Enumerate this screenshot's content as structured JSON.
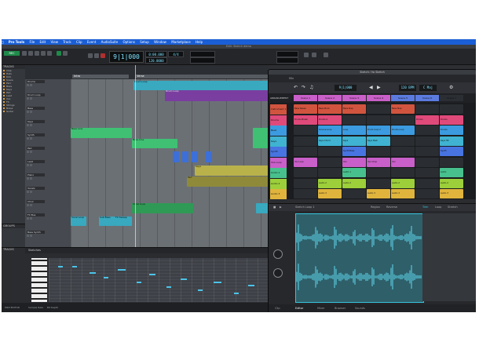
{
  "menubar": {
    "app_name": "Pro Tools",
    "items": [
      "File",
      "Edit",
      "View",
      "Track",
      "Clip",
      "Event",
      "AudioSuite",
      "Options",
      "Setup",
      "Window",
      "Marketplace",
      "Help"
    ]
  },
  "window_title": "Edit: Sketch demo",
  "transport": {
    "main_counter": "9|1|000",
    "sub_counter": "0:00.000",
    "tempo": "120.0000",
    "meter": "4/4",
    "record_button": "REC"
  },
  "tracklist": {
    "header": "TRACKS",
    "rows": [
      "Clap",
      "Hats",
      "Kick",
      "Snare",
      "Perc",
      "Bass",
      "Keys",
      "Pad",
      "Lead",
      "Vox",
      "FX",
      "Strings",
      "Brass",
      "Guitar"
    ]
  },
  "groups_header": "GROUPS",
  "edit": {
    "markers": [
      "Intro",
      "Verse"
    ],
    "track_names": [
      "Drums",
      "Drum Loop",
      "Bass",
      "Keys",
      "Synth",
      "Pad",
      "Lead",
      "Piano",
      "Vocals",
      "Choir",
      "FX Bus",
      "Bass Synth"
    ],
    "clip_labels": [
      "Drum Loop",
      "Drum Loop",
      "Bass Line",
      "Bass Line",
      "Keys",
      "Pad",
      "Vocal Loop",
      "Vocal Loop",
      "Sub Bass",
      "FX Sweep"
    ]
  },
  "bottom": {
    "tab": "Sketches",
    "status": "Midi Editor"
  },
  "statusbar": {
    "left": "MIDI EDITOR",
    "mid": "Sample Rate",
    "right": "Bit Depth"
  },
  "sketch": {
    "title": "Sketch: Ho Sketch",
    "bar": "Mix",
    "tempo_display": "120 BPM",
    "key_display": "C Maj",
    "counter": "9|1|000",
    "scene_label": "ARRANGEMENT",
    "scenes": [
      "Scene 1",
      "Scene 2",
      "Scene 3",
      "Scene 4",
      "Scene 5",
      "Scene 6",
      "Scene 7"
    ],
    "rows": [
      {
        "label": "Instrument 1",
        "color": "#d1543f",
        "cells": [
          "Bass Reese",
          "Bass Pluck",
          "Bass Slap",
          "",
          "Bass Slap",
          "",
          ""
        ]
      },
      {
        "label": "Drums",
        "color": "#e04a7b",
        "cells": [
          "Drums Break",
          "Drums A",
          "",
          "",
          "",
          "Drums",
          "Drums"
        ]
      },
      {
        "label": "Beat",
        "color": "#3c9be0",
        "cells": [
          "",
          "Groove Loop",
          "Loop",
          "Drum Loop 2",
          "Drums Loop",
          "",
          "Drums"
        ]
      },
      {
        "label": "Keys",
        "color": "#3fb3d1",
        "cells": [
          "",
          "Keys Chord",
          "Keys",
          "Keys Stab",
          "",
          "",
          "Keys Hit"
        ]
      },
      {
        "label": "Synth",
        "color": "#4774e0",
        "cells": [
          "",
          "",
          "Synth Bass",
          "",
          "",
          "",
          "Synth"
        ]
      },
      {
        "label": "Vox Loop",
        "color": "#c95fc8",
        "cells": [
          "Vox Loop",
          "",
          "Vox",
          "Vox Chop",
          "Vox",
          "",
          ""
        ]
      },
      {
        "label": "Audio 1",
        "color": "#47c08d",
        "cells": [
          "",
          "",
          "Audio 1",
          "",
          "",
          "",
          "Audio"
        ]
      },
      {
        "label": "Audio 2",
        "color": "#9ccf3a",
        "cells": [
          "",
          "Audio 2",
          "Audio 2",
          "",
          "Audio 2",
          "",
          "Audio 2"
        ]
      },
      {
        "label": "Audio 3",
        "color": "#e0b43c",
        "cells": [
          "",
          "Audio 3",
          "",
          "Audio 3",
          "Audio 3",
          "",
          "Audio 3"
        ]
      }
    ],
    "lower_clip_name": "Sketch Loop 1",
    "lower_buttons": [
      "Region",
      "Reverse",
      "Trim",
      "Loop",
      "Stretch"
    ],
    "tabs": [
      "Clip",
      "Editor",
      "Mixer",
      "Browser",
      "Sounds"
    ]
  },
  "colors": {
    "accent": "#1b5fd6",
    "clip_teal": "#38c4dc",
    "clip_green": "#3fc073",
    "clip_purple": "#7a3ea0",
    "clip_olive": "#b9b24a"
  }
}
